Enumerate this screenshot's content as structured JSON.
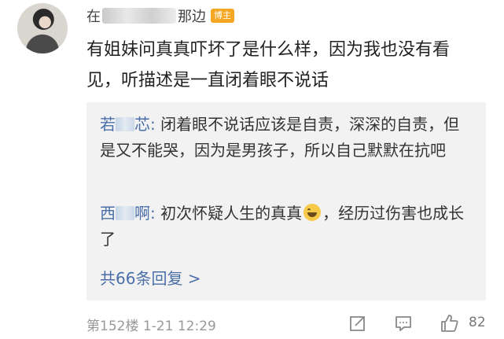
{
  "post": {
    "author_prefix": "在",
    "author_suffix": "那边",
    "badge": "博主",
    "text": "有姐妹问真真吓坏了是什么样，因为我也没有看见，听描述是一直闭着眼不说话"
  },
  "replies": [
    {
      "name_start": "若",
      "name_end": "芯",
      "text": "闭着眼不说话应该是自责，深深的自责，但是又不能哭，因为是男孩子，所以自己默默在抗吧"
    },
    {
      "name_start": "西",
      "name_end": "啊",
      "text_before_emoji": "初次怀疑人生的真真",
      "text_after_emoji": "，经历过伤害也成长了"
    }
  ],
  "more_replies": "共66条回复 >",
  "footer": {
    "meta": "第152楼  1-21 12:29",
    "like_count": "82"
  },
  "icons": {
    "share": "share-icon",
    "comment": "comment-icon",
    "like": "thumbs-up-icon"
  },
  "colors": {
    "link": "#4a6fa8",
    "badge": "#f5a623",
    "reply_bg": "#f2f2f2"
  }
}
